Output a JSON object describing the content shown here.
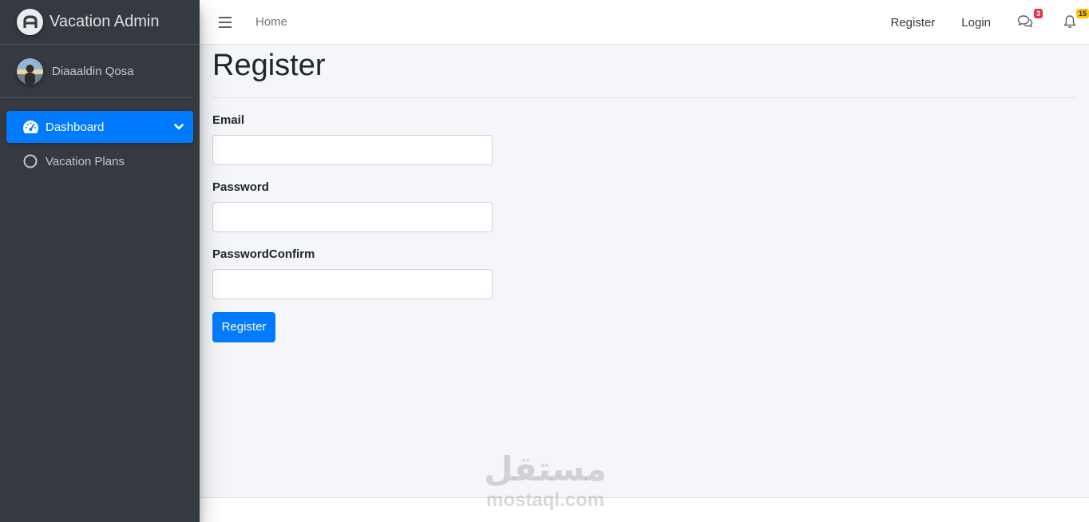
{
  "sidebar": {
    "brand": "Vacation Admin",
    "user_name": "Diaaaldin Qosa",
    "items": [
      {
        "label": "Dashboard",
        "icon": "tachometer-icon",
        "active": true
      },
      {
        "label": "Vacation Plans",
        "icon": "circle-icon",
        "active": false
      }
    ]
  },
  "topbar": {
    "home": "Home",
    "register": "Register",
    "login": "Login",
    "messages_count": "3",
    "notifications_count": "15"
  },
  "main": {
    "title": "Register",
    "fields": {
      "email": {
        "label": "Email",
        "value": "",
        "placeholder": ""
      },
      "password": {
        "label": "Password",
        "value": "",
        "placeholder": ""
      },
      "password_confirm": {
        "label": "PasswordConfirm",
        "value": "",
        "placeholder": ""
      }
    },
    "submit_label": "Register"
  },
  "watermark": {
    "arabic": "مستقل",
    "latin": "mostaql.com"
  },
  "colors": {
    "accent": "#007bff",
    "sidebar_bg": "#343a40",
    "content_bg": "#f4f6f9",
    "badge_red": "#dc3545",
    "badge_yellow": "#ffc107"
  }
}
